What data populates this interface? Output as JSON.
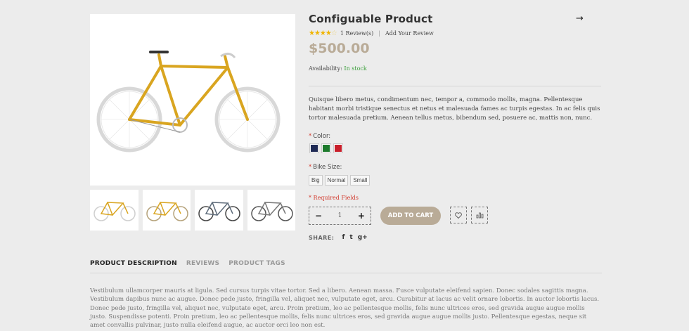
{
  "product": {
    "title": "Configuable Product",
    "rating_stars": 4,
    "reviews_link": "1 Review(s)",
    "add_review_link": "Add Your Review",
    "price": "$500.00",
    "availability_label": "Availability:",
    "availability_value": "In stock",
    "short_description": "Quisque libero metus, condimentum nec, tempor a, commodo mollis, magna. Pellentesque habitant morbi tristique senectus et netus et malesuada fames ac turpis egestas. In ac felis quis tortor malesuada pretium. Aenean tellus metus, bibendum sed, posuere ac, mattis non, nunc."
  },
  "options": {
    "required_mark": "*",
    "color_label": "Color:",
    "colors": [
      "#1f2a55",
      "#1d7a2c",
      "#c81e2a"
    ],
    "size_label": "Bike Size:",
    "sizes": [
      "Big",
      "Normal",
      "Small"
    ],
    "required_fields": "* Required Fields"
  },
  "cart": {
    "qty_minus": "−",
    "qty_value": "1",
    "qty_plus": "+",
    "add_to_cart": "ADD TO CART"
  },
  "share": {
    "label": "SHARE:",
    "facebook": "f",
    "twitter": "t",
    "googleplus": "g+"
  },
  "tabs": [
    {
      "label": "PRODUCT DESCRIPTION"
    },
    {
      "label": "REVIEWS"
    },
    {
      "label": "PRODUCT TAGS"
    }
  ],
  "description": "Vestibulum ullamcorper mauris at ligula. Sed cursus turpis vitae tortor. Sed a libero. Aenean massa. Fusce vulputate eleifend sapien. Donec sodales sagittis magna. Vestibulum dapibus nunc ac augue. Donec pede justo, fringilla vel, aliquet nec, vulputate eget, arcu. Curabitur at lacus ac velit ornare lobortis. In auctor lobortis lacus. Donec pede justo, fringilla vel, aliquet nec, vulputate eget, arcu. Proin pretium, leo ac pellentesque mollis, felis nunc ultrices eros, sed gravida augue augue mollis justo. Suspendisse potenti. Proin pretium, leo ac pellentesque mollis, felis nunc ultrices eros, sed gravida augue augue mollis justo. Pellentesque egestas, neque sit amet convallis pulvinar, justo nulla eleifend augue, ac auctor orci leo non est.",
  "thumbnails": [
    {
      "frame_color": "#d9a520",
      "wheel_color": "#cfcfcf"
    },
    {
      "frame_color": "#d9a520",
      "wheel_color": "#b5a27a"
    },
    {
      "frame_color": "#5d6b7a",
      "wheel_color": "#444444"
    },
    {
      "frame_color": "#777777",
      "wheel_color": "#555555"
    }
  ],
  "icons": {
    "next": "arrow-right-icon",
    "wishlist": "heart-icon",
    "compare": "compare-chart-icon"
  }
}
